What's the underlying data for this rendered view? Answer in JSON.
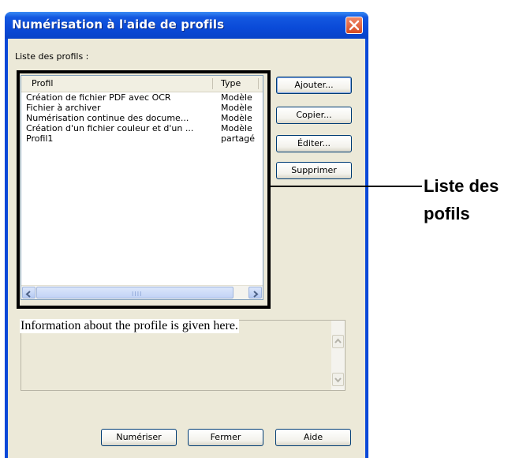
{
  "window": {
    "title": "Numérisation à l'aide de profils"
  },
  "profiles": {
    "label": "Liste des profils :",
    "columns": [
      "Profil",
      "Type"
    ],
    "rows": [
      {
        "name": "Création de fichier PDF avec OCR",
        "type": "Modèle"
      },
      {
        "name": "Fichier à archiver",
        "type": "Modèle"
      },
      {
        "name": "Numérisation continue des docume...",
        "type": "Modèle"
      },
      {
        "name": "Création d'un fichier couleur et d'un ...",
        "type": "Modèle"
      },
      {
        "name": "Profil1",
        "type": "partagé"
      }
    ],
    "scroll_grip": "IIII"
  },
  "buttons": {
    "add": "Ajouter...",
    "copy": "Copier...",
    "edit": "Éditer...",
    "delete": "Supprimer",
    "scan": "Numériser",
    "close": "Fermer",
    "help": "Aide"
  },
  "info": {
    "text": "Information about the profile is given here."
  },
  "callout": {
    "line1": "Liste des",
    "line2": "pofils"
  },
  "icons": [
    "close-icon",
    "arrow-left-icon",
    "arrow-right-icon",
    "arrow-up-icon",
    "arrow-down-icon"
  ]
}
